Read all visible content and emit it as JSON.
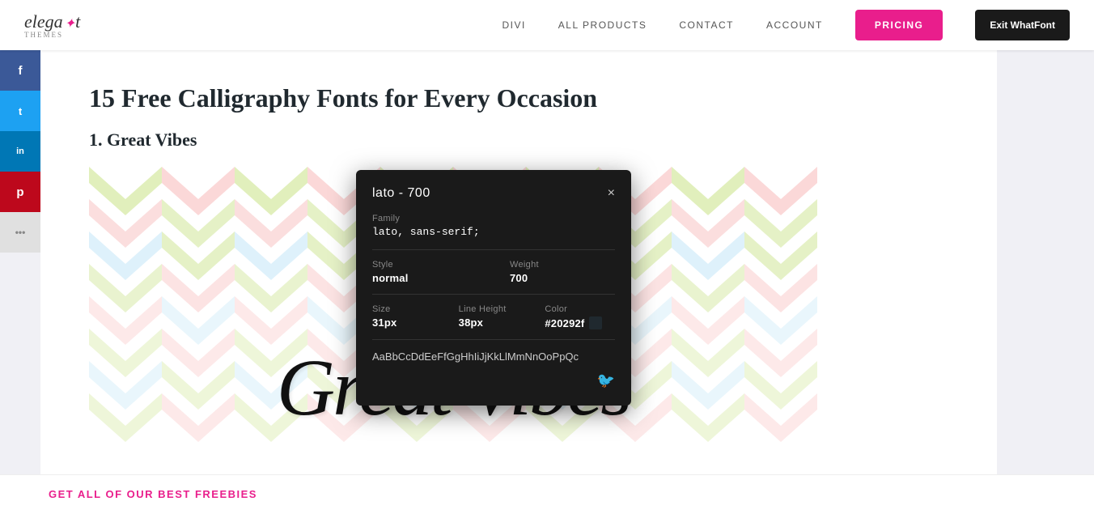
{
  "header": {
    "logo_brand": "elegant",
    "logo_sub": "themes",
    "nav": {
      "items": [
        {
          "label": "DIVI",
          "id": "divi"
        },
        {
          "label": "ALL PRODUCTS",
          "id": "all-products"
        },
        {
          "label": "CONTACT",
          "id": "contact"
        },
        {
          "label": "ACCOUNT",
          "id": "account"
        }
      ],
      "pricing_label": "PRICING",
      "exit_whatfont_label": "Exit WhatFont"
    }
  },
  "social": {
    "buttons": [
      {
        "icon": "f",
        "label": "facebook",
        "class": "social-fb"
      },
      {
        "icon": "t",
        "label": "twitter",
        "class": "social-tw"
      },
      {
        "icon": "in",
        "label": "linkedin",
        "class": "social-li"
      },
      {
        "icon": "p",
        "label": "pinterest",
        "class": "social-pi"
      },
      {
        "icon": "...",
        "label": "more",
        "class": "social-more"
      }
    ]
  },
  "content": {
    "page_title": "15 Free Calligraphy Fonts for Every Occasion",
    "section_heading": "1. Great Vibes",
    "font_display_text": "Great Vibes"
  },
  "whatfont_popup": {
    "title": "lato - 700",
    "close_label": "×",
    "family_label": "Family",
    "family_value": "lato, sans-serif;",
    "style_label": "Style",
    "style_value": "normal",
    "weight_label": "Weight",
    "weight_value": "700",
    "size_label": "Size",
    "size_value": "31px",
    "line_height_label": "Line Height",
    "line_height_value": "38px",
    "color_label": "Color",
    "color_value": "#20292f",
    "color_hex": "#20292f",
    "alphabet": "AaBbCcDdEeFfGgHhIiJjKkLlMmNnOoPpQc"
  },
  "bottom_banner": {
    "text": "GET ALL OF OUR BEST FREEBIES"
  }
}
